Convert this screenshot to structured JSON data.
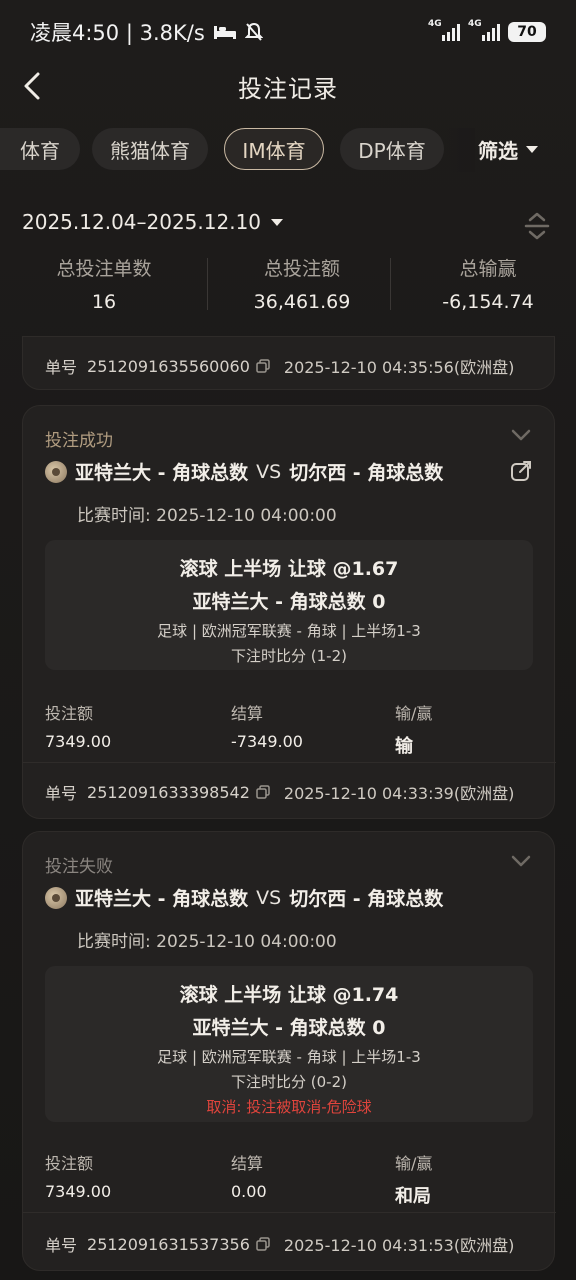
{
  "status_bar": {
    "time_speed": "凌晨4:50 | 3.8K/s",
    "net1": "4G",
    "net2": "4G",
    "battery": "70"
  },
  "header": {
    "title": "投注记录"
  },
  "tabs": [
    {
      "label": "体育",
      "active": false
    },
    {
      "label": "熊猫体育",
      "active": false
    },
    {
      "label": "IM体育",
      "active": true
    },
    {
      "label": "DP体育",
      "active": false
    }
  ],
  "filter_label": "筛选",
  "date_range": "2025.12.04–2025.12.10",
  "stats": [
    {
      "label": "总投注单数",
      "value": "16"
    },
    {
      "label": "总投注额",
      "value": "36,461.69"
    },
    {
      "label": "总输赢",
      "value": "-6,154.74"
    }
  ],
  "partial_card": {
    "order_label": "单号",
    "order_no": "2512091635560060",
    "time": "2025-12-10 04:35:56(欧洲盘)"
  },
  "bets": [
    {
      "status": "投注成功",
      "home": "亚特兰大 - 角球总数",
      "vs": "VS",
      "away": "切尔西 - 角球总数",
      "match_time": "比赛时间: 2025-12-10 04:00:00",
      "line1": "滚球 上半场 让球 @1.67",
      "line2": "亚特兰大 - 角球总数 0",
      "line3": "足球 | 欧洲冠军联赛 -  角球  | 上半场1-3",
      "line4": "下注时比分 (1-2)",
      "line5": "",
      "stake_label": "投注额",
      "stake": "7349.00",
      "settle_label": "结算",
      "settle": "-7349.00",
      "result_label": "输/赢",
      "result": "输",
      "order_label": "单号",
      "order_no": "2512091633398542",
      "time": "2025-12-10 04:33:39(欧洲盘)"
    },
    {
      "status": "投注失败",
      "home": "亚特兰大 - 角球总数",
      "vs": "VS",
      "away": "切尔西 - 角球总数",
      "match_time": "比赛时间: 2025-12-10 04:00:00",
      "line1": "滚球 上半场 让球 @1.74",
      "line2": "亚特兰大 - 角球总数 0",
      "line3": "足球 | 欧洲冠军联赛 -  角球  | 上半场1-3",
      "line4": "下注时比分 (0-2)",
      "line5": "取消: 投注被取消-危险球",
      "stake_label": "投注额",
      "stake": "7349.00",
      "settle_label": "结算",
      "settle": "0.00",
      "result_label": "输/赢",
      "result": "和局",
      "order_label": "单号",
      "order_no": "2512091631537356",
      "time": "2025-12-10 04:31:53(欧洲盘)"
    }
  ],
  "colors": {
    "background": "#1a1818",
    "card": "#232120",
    "accent_gold": "#b09c80",
    "cancel_red": "#e0443c"
  }
}
